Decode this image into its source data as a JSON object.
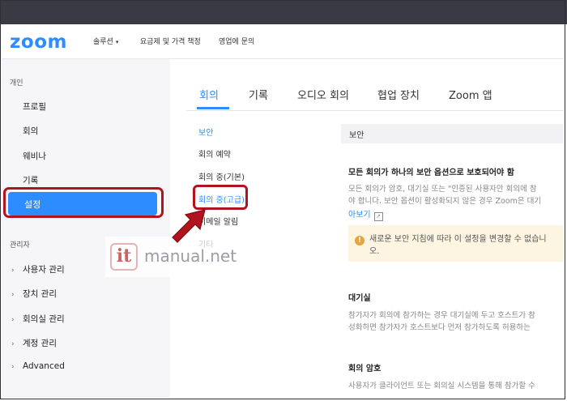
{
  "header": {
    "logo": "zoom",
    "nav": [
      "솔루션",
      "요금제 및 가격 책정",
      "영업에 문의"
    ],
    "caret": "▾"
  },
  "sidebar": {
    "personal_label": "개인",
    "personal_items": [
      "프로필",
      "회의",
      "웨비나",
      "기록"
    ],
    "selected_item": "설정",
    "admin_label": "관리자",
    "admin_items": [
      "사용자 관리",
      "장치 관리",
      "회의실 관리",
      "계정 관리",
      "Advanced"
    ],
    "chevron": "›"
  },
  "tabs": [
    "회의",
    "기록",
    "오디오 회의",
    "협업 장치",
    "Zoom 앱"
  ],
  "subnav": [
    "보안",
    "회의 예약",
    "회의 중(기본)",
    "회의 중(고급)",
    "이메일 알림",
    "기타"
  ],
  "content": {
    "section_header": "보안",
    "security_title": "모든 회의가 하나의 보안 옵션으로 보호되어야 함",
    "security_desc_1": "모든 회의가 암호, 대기실 또는 \"인증된 사용자만 회의에 참",
    "security_desc_2": "야 합니다. 보안 옵션이 활성화되지 않은 경우 Zoom은 대기",
    "learn_more": "아보기",
    "notice_line_1": "새로운 보안 지침에 따라 이 설정을 변경할 수 없습니",
    "notice_line_2": "오.",
    "waiting_title": "대기실",
    "waiting_desc_1": "참가자가 회의에 참가하는 경우 대기실에 두고 호스트가 참",
    "waiting_desc_2": "성화하면 참가자가 호스트보다 먼저 참가하도록 허용하는 ",
    "password_title": "회의 암호",
    "password_desc_1": "사용자가 클라이언트 또는 회의실 시스템을 통해 참가할 수"
  },
  "watermark": {
    "logo": "it",
    "text": "manual.net"
  },
  "colors": {
    "accent": "#2d8cff",
    "highlight": "#b0141e",
    "arrow": "#b0141e"
  }
}
